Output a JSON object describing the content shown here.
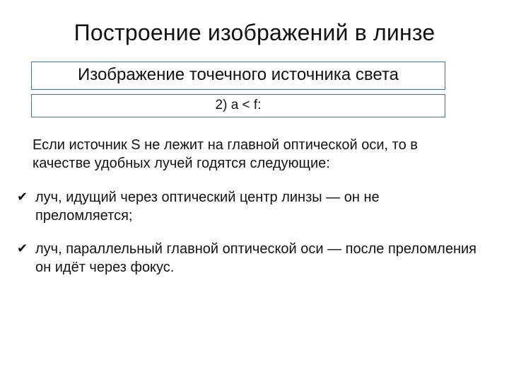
{
  "title": "Построение изображений в линзе",
  "subtitle_box": "Изображение точечного источника света",
  "case_box": "2)   a < f:",
  "lead": "Если источник S не лежит на главной оптической оси, то в качестве удобных лучей годятся следующие:",
  "bullets": [
    "луч, идущий через оптический центр линзы — он не преломляется;",
    "луч, параллельный главной оптической оси — после преломления он идёт через фокус."
  ]
}
